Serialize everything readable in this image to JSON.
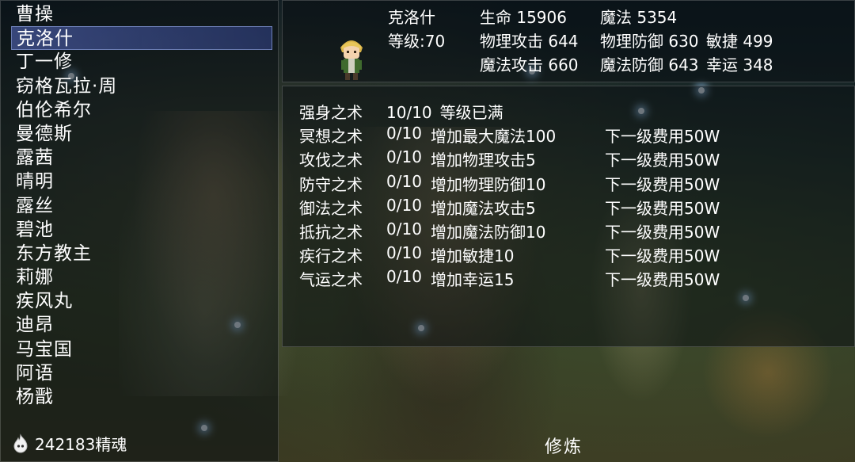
{
  "characters": [
    "曹操",
    "克洛什",
    "丁一修",
    "窃格瓦拉·周",
    "伯伦希尔",
    "曼德斯",
    "露茜",
    "晴明",
    "露丝",
    "碧池",
    "东方教主",
    "莉娜",
    "疾风丸",
    "迪昂",
    "马宝国",
    "阿语",
    "杨戬"
  ],
  "selected_index": 1,
  "soul": {
    "amount_text": "242183精魂"
  },
  "screen_title": "修炼",
  "hero": {
    "name": "克洛什",
    "level": "等级:70",
    "hp": "生命 15906",
    "mp": "魔法 5354",
    "patk": "物理攻击 644",
    "pdef": "物理防御 630",
    "agi": "敏捷 499",
    "matk": "魔法攻击 660",
    "mdef": "魔法防御 643",
    "luck": "幸运 348"
  },
  "skills": [
    {
      "name": "强身之术",
      "level": "10/10",
      "desc": "等级已满",
      "cost": ""
    },
    {
      "name": "冥想之术",
      "level": "0/10",
      "desc": "增加最大魔法100",
      "cost": "下一级费用50W"
    },
    {
      "name": "攻伐之术",
      "level": "0/10",
      "desc": "增加物理攻击5",
      "cost": "下一级费用50W"
    },
    {
      "name": "防守之术",
      "level": "0/10",
      "desc": "增加物理防御10",
      "cost": "下一级费用50W"
    },
    {
      "name": "御法之术",
      "level": "0/10",
      "desc": "增加魔法攻击5",
      "cost": "下一级费用50W"
    },
    {
      "name": "抵抗之术",
      "level": "0/10",
      "desc": "增加魔法防御10",
      "cost": "下一级费用50W"
    },
    {
      "name": "疾行之术",
      "level": "0/10",
      "desc": "增加敏捷10",
      "cost": "下一级费用50W"
    },
    {
      "name": "气运之术",
      "level": "0/10",
      "desc": "增加幸运15",
      "cost": "下一级费用50W"
    }
  ],
  "colors": {
    "selection": "#4a5cb0",
    "text": "#ffffff",
    "panel": "#0a0e12"
  }
}
